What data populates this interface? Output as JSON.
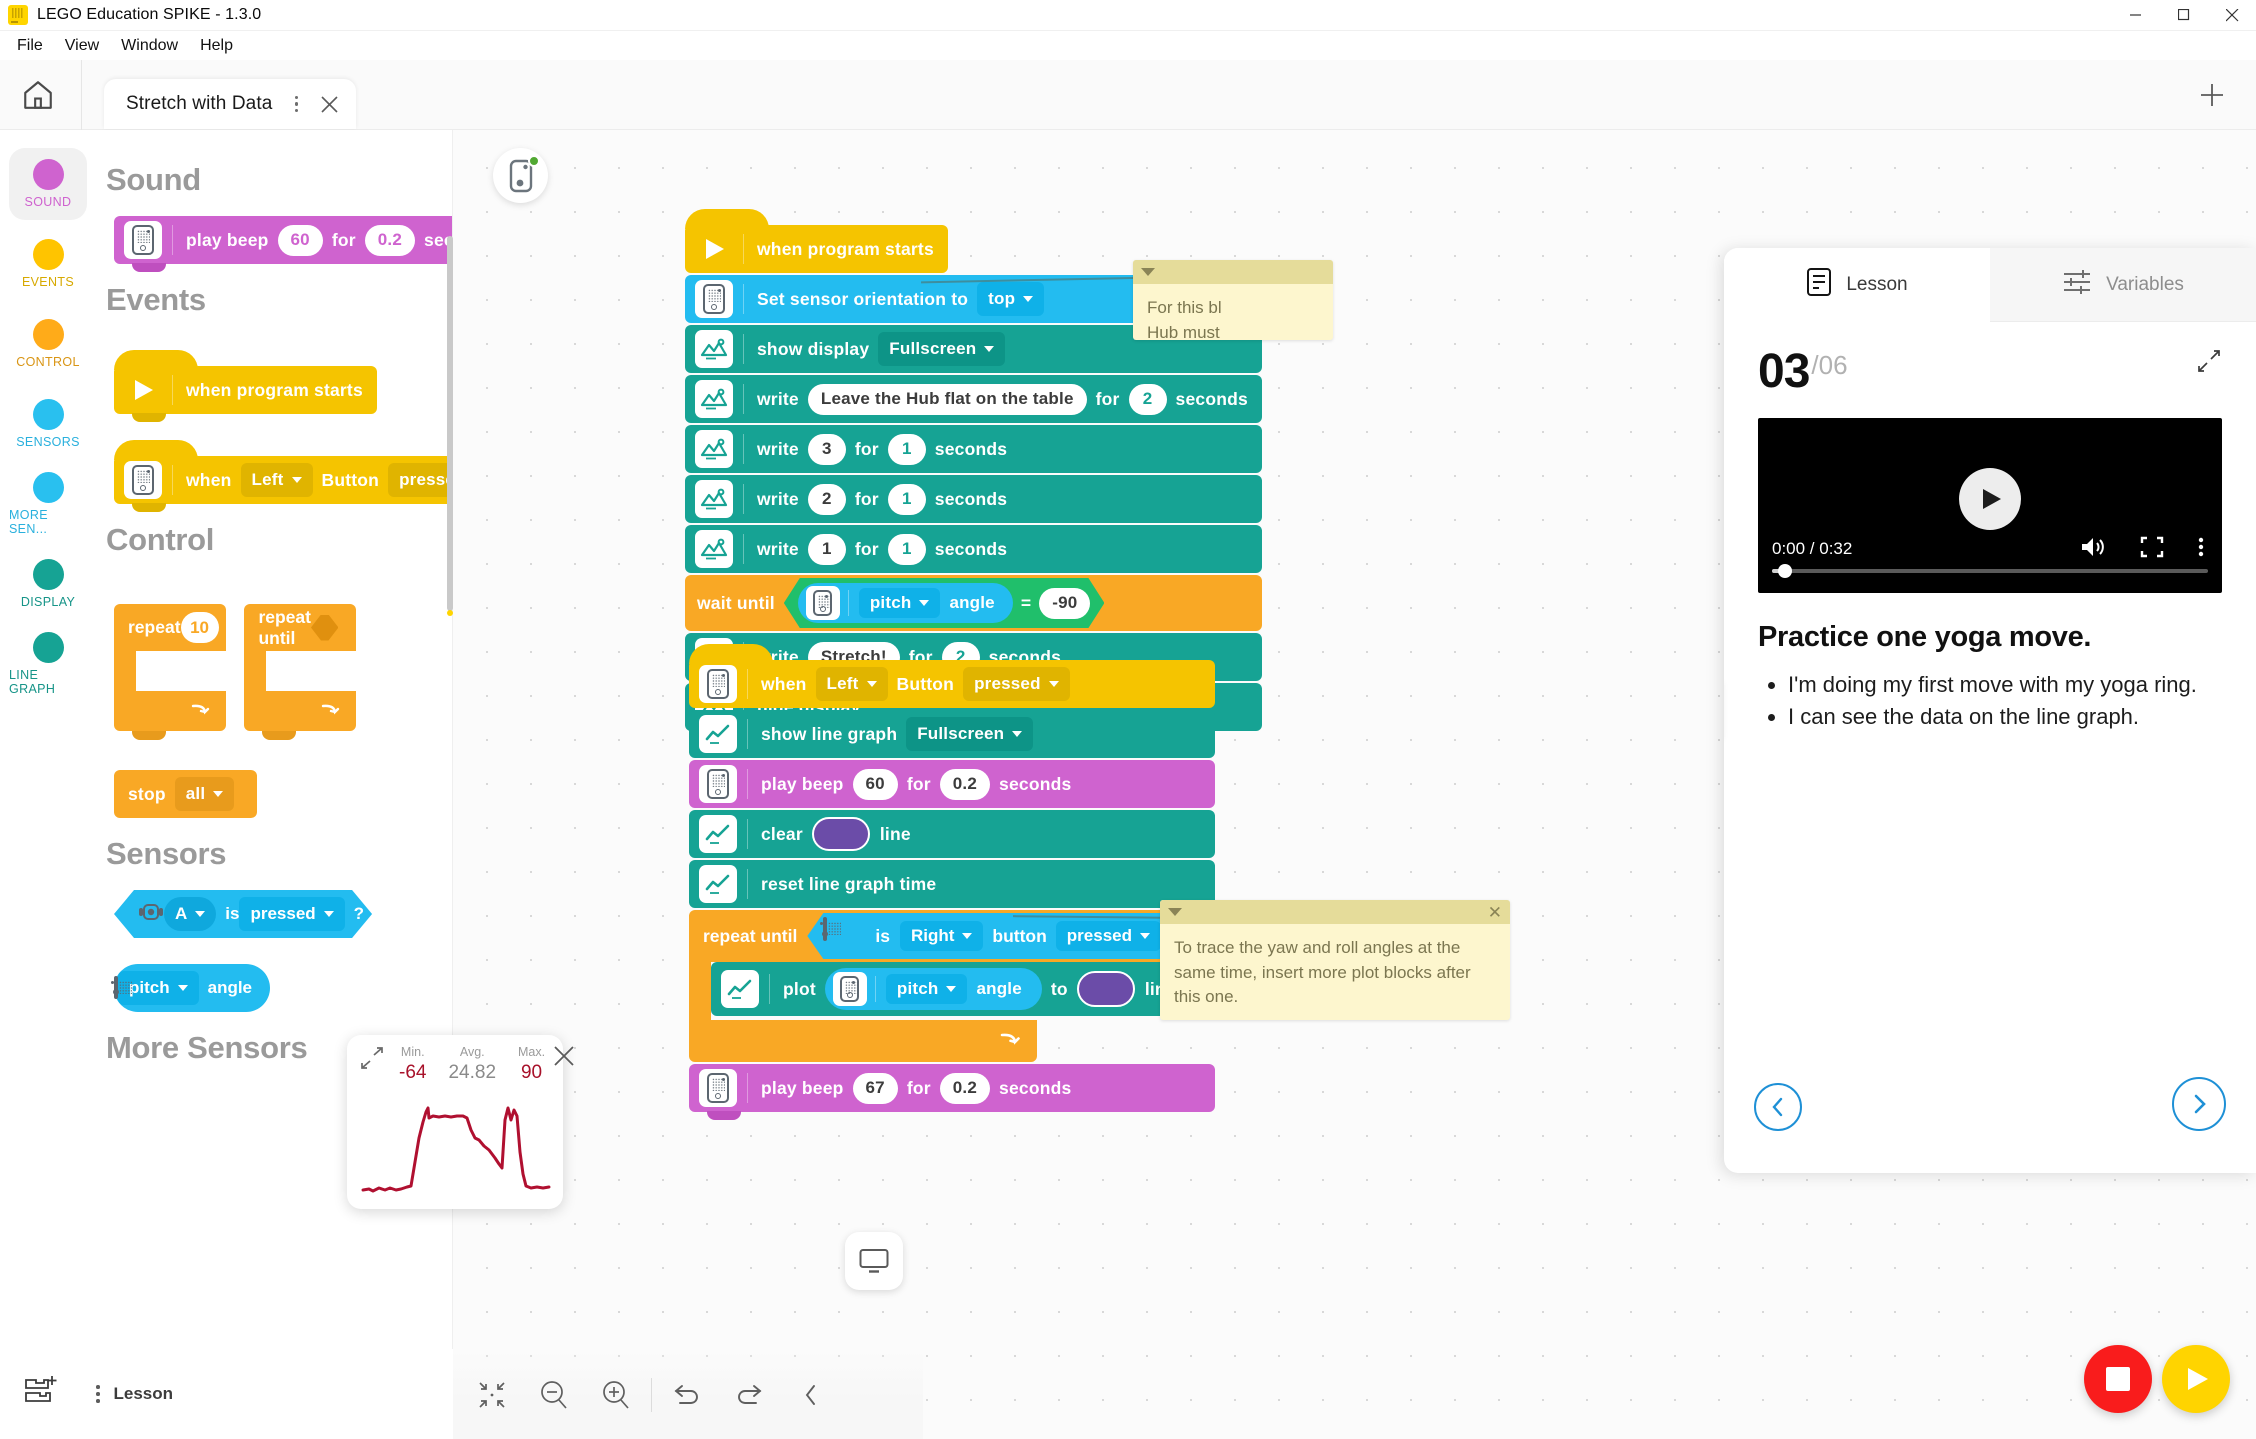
{
  "window": {
    "title": "LEGO Education SPIKE - 1.3.0",
    "minimize_label": "Minimize",
    "maximize_label": "Maximize",
    "close_label": "Close"
  },
  "menu": {
    "items": [
      "File",
      "View",
      "Window",
      "Help"
    ]
  },
  "header": {
    "home_label": "Home",
    "tab_name": "Stretch with Data",
    "tab_menu_label": "More options",
    "tab_close_label": "Close tab",
    "add_tab_label": "New project"
  },
  "rail": {
    "categories": [
      {
        "label": "SOUND",
        "color": "#cf63cf",
        "active": true
      },
      {
        "label": "EVENTS",
        "color": "#ffc400",
        "active": false
      },
      {
        "label": "CONTROL",
        "color": "#ffab19",
        "active": false
      },
      {
        "label": "SENSORS",
        "color": "#29c0ef",
        "active": false
      },
      {
        "label": "MORE SEN...",
        "color": "#29c0ef",
        "active": false
      },
      {
        "label": "DISPLAY",
        "color": "#16a394",
        "active": false
      },
      {
        "label": "LINE GRAPH",
        "color": "#16a394",
        "active": false
      }
    ]
  },
  "palette": {
    "sections": [
      {
        "heading": "Sound"
      },
      {
        "heading": "Events"
      },
      {
        "heading": "Control"
      },
      {
        "heading": "Sensors"
      },
      {
        "heading": "More Sensors"
      }
    ],
    "sound_beep": {
      "label": "play beep",
      "note": "60",
      "for": "for",
      "duration": "0.2",
      "unit": "seconds"
    },
    "events_start": {
      "label": "when program starts"
    },
    "events_button": {
      "when": "when",
      "button_side": "Left",
      "button_word": "Button",
      "state": "pressed"
    },
    "control_repeat": {
      "label": "repeat",
      "count": "10"
    },
    "control_repeat_until": {
      "label": "repeat until"
    },
    "control_stop": {
      "label": "stop",
      "target": "all"
    },
    "sensors_pressed": {
      "port": "A",
      "is": "is",
      "state": "pressed",
      "question": "?"
    },
    "sensors_angle": {
      "axis": "pitch",
      "label": "angle"
    }
  },
  "canvas": {
    "hub_status_label": "Hub connected",
    "stack_one": [
      {
        "type": "hat",
        "category": "events",
        "text": "when program starts"
      },
      {
        "type": "cmd",
        "category": "sensors",
        "text": "Set sensor orientation to",
        "dropdown": "top"
      },
      {
        "type": "cmd",
        "category": "display",
        "text": "show display",
        "dropdown": "Fullscreen"
      },
      {
        "type": "write",
        "category": "display",
        "label": "write",
        "value": "Leave the Hub flat on the table",
        "for": "for",
        "duration": "2",
        "unit": "seconds"
      },
      {
        "type": "write",
        "category": "display",
        "label": "write",
        "value": "3",
        "for": "for",
        "duration": "1",
        "unit": "seconds"
      },
      {
        "type": "write",
        "category": "display",
        "label": "write",
        "value": "2",
        "for": "for",
        "duration": "1",
        "unit": "seconds"
      },
      {
        "type": "write",
        "category": "display",
        "label": "write",
        "value": "1",
        "for": "for",
        "duration": "1",
        "unit": "seconds"
      },
      {
        "type": "waituntil",
        "category": "control",
        "label": "wait until",
        "axis": "pitch",
        "angle_word": "angle",
        "operator": "=",
        "operand": "-90"
      },
      {
        "type": "write",
        "category": "display",
        "label": "write",
        "value": "Stretch!",
        "for": "for",
        "duration": "2",
        "unit": "seconds"
      },
      {
        "type": "cmd",
        "category": "display",
        "text": "hide display"
      }
    ],
    "stack_two": [
      {
        "type": "hat",
        "category": "events",
        "when": "when",
        "button_side": "Left",
        "button_word": "Button",
        "state": "pressed"
      },
      {
        "type": "cmd",
        "category": "linegraph",
        "text": "show line graph",
        "dropdown": "Fullscreen"
      },
      {
        "type": "beep",
        "category": "sound",
        "label": "play beep",
        "note": "60",
        "for": "for",
        "duration": "0.2",
        "unit": "seconds"
      },
      {
        "type": "clear",
        "category": "linegraph",
        "label": "clear",
        "color": "#6b4ca8",
        "suffix": "line"
      },
      {
        "type": "cmd",
        "category": "linegraph",
        "text": "reset line graph time"
      },
      {
        "type": "repeatuntil",
        "category": "control",
        "label": "repeat until",
        "is": "is",
        "button_side": "Right",
        "button_word": "button",
        "state": "pressed",
        "question": "?"
      },
      {
        "type": "plot",
        "category": "linegraph",
        "label": "plot",
        "axis": "pitch",
        "angle_word": "angle",
        "to": "to",
        "color": "#6b4ca8",
        "suffix": "line"
      },
      {
        "type": "beep",
        "category": "sound",
        "label": "play beep",
        "note": "67",
        "for": "for",
        "duration": "0.2",
        "unit": "seconds"
      }
    ],
    "note_top": {
      "text": "For this bl\nHub must",
      "collapse_label": "Collapse",
      "close_label": "Close"
    },
    "note_bottom": {
      "text": "To trace the yaw and roll angles at the same time, insert more plot blocks after this one.",
      "collapse_label": "Collapse",
      "close_label": "Close"
    }
  },
  "line_graph_panel": {
    "expand_label": "Expand graph",
    "close_label": "Close graph",
    "stats": [
      {
        "key": "Min.",
        "value": "-64",
        "color": "#a8112a"
      },
      {
        "key": "Avg.",
        "value": "24.82",
        "color": "#808080"
      },
      {
        "key": "Max.",
        "value": "90",
        "color": "#a8112a"
      }
    ],
    "series_color": "#b01030"
  },
  "bottom_toolbar": {
    "buttons": [
      {
        "name": "fit-to-screen",
        "label": "Fit to screen"
      },
      {
        "name": "zoom-out",
        "label": "Zoom out"
      },
      {
        "name": "zoom-in",
        "label": "Zoom in"
      },
      {
        "name": "undo",
        "label": "Undo"
      },
      {
        "name": "redo",
        "label": "Redo"
      },
      {
        "name": "collapse-panel",
        "label": "Collapse"
      }
    ],
    "monitor_label": "Device monitor"
  },
  "lesson_bar": {
    "add_label": "Add extension",
    "menu_label": "Lesson options",
    "label": "Lesson"
  },
  "lesson_panel": {
    "tabs": [
      {
        "label": "Lesson",
        "icon": "document-icon",
        "active": true
      },
      {
        "label": "Variables",
        "icon": "sliders-icon",
        "active": false
      }
    ],
    "step_current": "03",
    "step_total": "/06",
    "expand_label": "Expand lesson",
    "video": {
      "current_time": "0:00",
      "separator": " / ",
      "total_time": "0:32",
      "time_display": "0:00 / 0:32",
      "play_label": "Play",
      "mute_label": "Mute",
      "fullscreen_label": "Full screen",
      "more_label": "More options"
    },
    "title": "Practice one yoga move.",
    "bullets": [
      "I'm doing my first move with my yoga ring.",
      "I can see the data on the line graph."
    ],
    "prev_label": "Previous step",
    "next_label": "Next step",
    "drag_label": "Resize panel"
  },
  "run_controls": {
    "stop_label": "Stop",
    "play_label": "Play",
    "stop_color": "#f91c1c",
    "play_color": "#ffd400"
  }
}
